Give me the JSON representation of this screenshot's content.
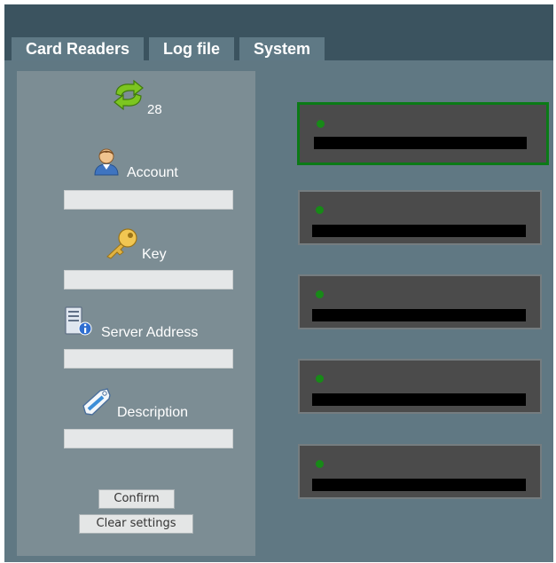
{
  "tabs": [
    {
      "label": "Card Readers",
      "active": true
    },
    {
      "label": "Log file",
      "active": false
    },
    {
      "label": "System",
      "active": false
    }
  ],
  "refresh": {
    "icon": "refresh-icon",
    "count": "28"
  },
  "form": {
    "account": {
      "label": "Account",
      "icon": "user-icon",
      "value": ""
    },
    "key": {
      "label": "Key",
      "icon": "key-icon",
      "value": ""
    },
    "server": {
      "label": "Server Address",
      "icon": "server-info-icon",
      "value": ""
    },
    "description": {
      "label": "Description",
      "icon": "tag-icon",
      "value": ""
    }
  },
  "buttons": {
    "confirm": "Confirm",
    "clear": "Clear settings"
  },
  "readers": [
    {
      "selected": true,
      "status": "online"
    },
    {
      "selected": false,
      "status": "online"
    },
    {
      "selected": false,
      "status": "online"
    },
    {
      "selected": false,
      "status": "online"
    },
    {
      "selected": false,
      "status": "online"
    }
  ],
  "colors": {
    "background": "#607883",
    "header": "#3b535f",
    "panel": "#7c8d94",
    "reader": "#4b4b4b",
    "selected_border": "#0b7a16",
    "status_online": "#178a17"
  }
}
